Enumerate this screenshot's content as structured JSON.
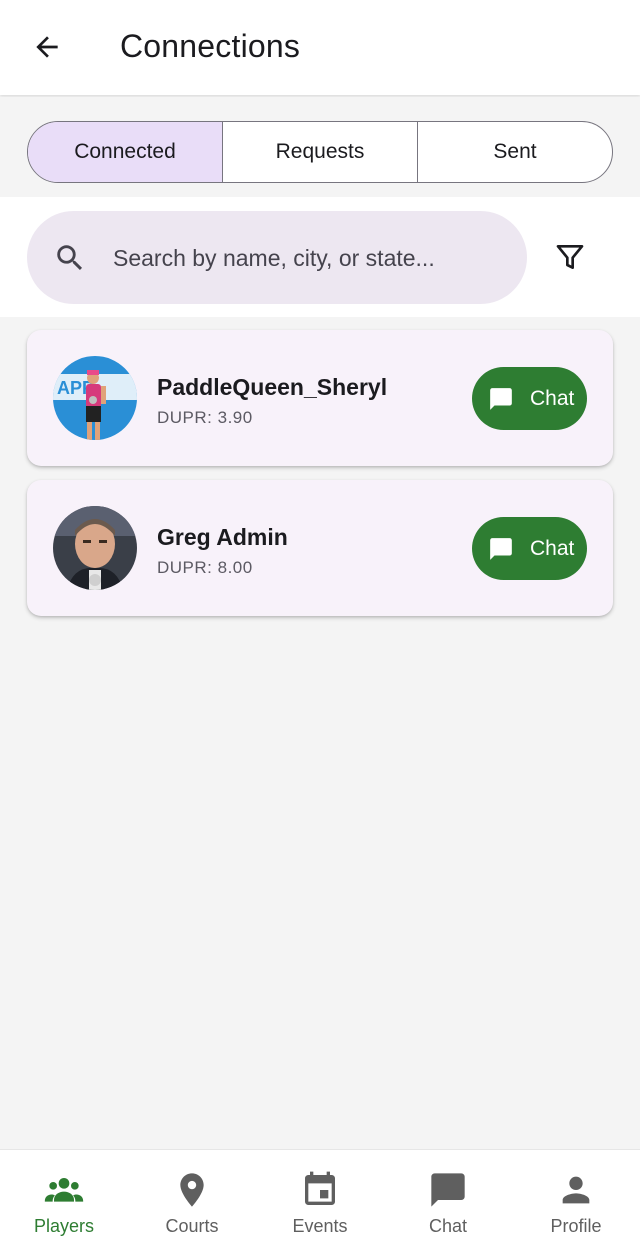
{
  "header": {
    "title": "Connections",
    "back_icon": "arrow-back-icon"
  },
  "tabs": [
    {
      "label": "Connected",
      "active": true
    },
    {
      "label": "Requests",
      "active": false
    },
    {
      "label": "Sent",
      "active": false
    }
  ],
  "search": {
    "placeholder": "Search by name, city, or state...",
    "value": "",
    "icon": "search-icon",
    "filter_icon": "filter-icon"
  },
  "connections": [
    {
      "name": "PaddleQueen_Sheryl",
      "dupr": "DUPR: 3.90",
      "chat_label": "Chat"
    },
    {
      "name": "Greg Admin",
      "dupr": "DUPR: 8.00",
      "chat_label": "Chat"
    }
  ],
  "bottom_nav": [
    {
      "label": "Players",
      "icon": "people-icon",
      "active": true
    },
    {
      "label": "Courts",
      "icon": "location-pin-icon",
      "active": false
    },
    {
      "label": "Events",
      "icon": "calendar-icon",
      "active": false
    },
    {
      "label": "Chat",
      "icon": "chat-bubble-icon",
      "active": false
    },
    {
      "label": "Profile",
      "icon": "person-icon",
      "active": false
    }
  ],
  "colors": {
    "accent_green": "#2e7d32",
    "tab_active_bg": "#e9ddf8",
    "search_bg": "#ede7f1",
    "card_bg": "#f8f2fa"
  }
}
